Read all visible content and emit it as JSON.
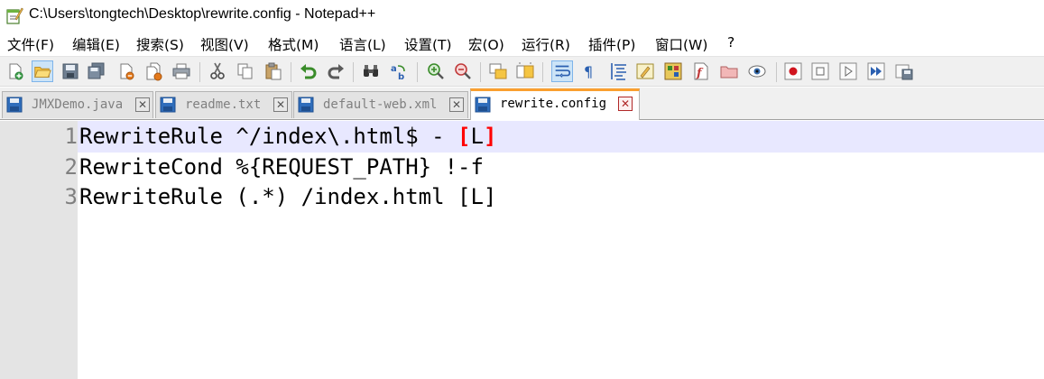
{
  "window": {
    "title": "C:\\Users\\tongtech\\Desktop\\rewrite.config - Notepad++"
  },
  "menu": [
    {
      "label": "文件(F)"
    },
    {
      "label": "编辑(E)"
    },
    {
      "label": "搜索(S)"
    },
    {
      "label": "视图(V)"
    },
    {
      "label": "格式(M)"
    },
    {
      "label": "语言(L)"
    },
    {
      "label": "设置(T)"
    },
    {
      "label": "宏(O)"
    },
    {
      "label": "运行(R)"
    },
    {
      "label": "插件(P)"
    },
    {
      "label": "窗口(W)"
    },
    {
      "label": "?"
    }
  ],
  "toolbar": {
    "icons": [
      "new-file-icon",
      "open-file-icon",
      "save-icon",
      "save-all-icon",
      "close-icon",
      "close-all-icon",
      "print-icon",
      "cut-icon",
      "copy-icon",
      "paste-icon",
      "undo-icon",
      "redo-icon",
      "find-icon",
      "replace-icon",
      "zoom-in-icon",
      "zoom-out-icon",
      "sync-vertical-icon",
      "sync-horizontal-icon",
      "word-wrap-icon",
      "show-all-chars-icon",
      "indent-guide-icon",
      "udl-icon",
      "doc-map-icon",
      "function-list-icon",
      "folder-workspace-icon",
      "monitoring-icon",
      "record-macro-icon",
      "stop-macro-icon",
      "play-macro-icon",
      "run-macro-multiple-icon",
      "save-macro-icon"
    ]
  },
  "tabs": [
    {
      "label": "JMXDemo.java",
      "active": false
    },
    {
      "label": "readme.txt",
      "active": false
    },
    {
      "label": "default-web.xml",
      "active": false
    },
    {
      "label": "rewrite.config",
      "active": true
    }
  ],
  "editor": {
    "lines": [
      {
        "number": "1",
        "before": "RewriteRule ^/index\\.html$ - ",
        "bracket_open": "[",
        "mid": "L",
        "bracket_close": "]"
      },
      {
        "number": "2",
        "text": "RewriteCond %{REQUEST_PATH} !-f"
      },
      {
        "number": "3",
        "text": "RewriteRule (.*) /index.html [L]"
      }
    ],
    "colors": {
      "current_line": "#e8e8ff",
      "brace_match": "#ff0000",
      "gutter": "#e4e4e4",
      "active_tab_accent": "#fa9f2f"
    }
  }
}
